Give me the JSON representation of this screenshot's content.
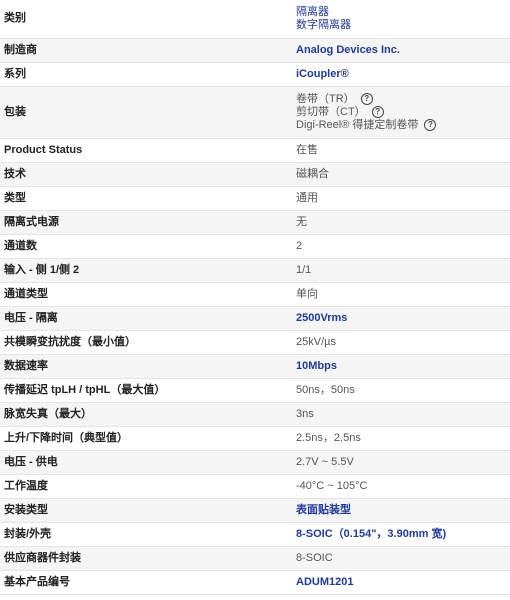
{
  "rows": [
    {
      "label": "类别",
      "values": [
        "隔离器",
        "数字隔离器"
      ]
    },
    {
      "label": "制造商",
      "value": "Analog Devices Inc."
    },
    {
      "label": "系列",
      "value": "iCoupler®"
    },
    {
      "label": "包装",
      "packaging": [
        "卷带（TR）",
        "剪切带（CT）",
        "Digi-Reel® 得捷定制卷带"
      ],
      "help_icon": "question-circle-icon"
    },
    {
      "label": "Product Status",
      "value": "在售"
    },
    {
      "label": "技术",
      "value": "磁耦合"
    },
    {
      "label": "类型",
      "value": "通用"
    },
    {
      "label": "隔离式电源",
      "value": "无"
    },
    {
      "label": "通道数",
      "value": "2"
    },
    {
      "label": "输入 - 侧 1/侧 2",
      "value": "1/1"
    },
    {
      "label": "通道类型",
      "value": "单向"
    },
    {
      "label": "电压 - 隔离",
      "value": "2500Vrms"
    },
    {
      "label": "共模瞬变抗扰度（最小值）",
      "value": "25kV/µs"
    },
    {
      "label": "数据速率",
      "value": "10Mbps"
    },
    {
      "label": "传播延迟 tpLH / tpHL（最大值）",
      "value": "50ns，50ns"
    },
    {
      "label": "脉宽失真（最大）",
      "value": "3ns"
    },
    {
      "label": "上升/下降时间（典型值）",
      "value": "2.5ns，2.5ns"
    },
    {
      "label": "电压 - 供电",
      "value": "2.7V ~ 5.5V"
    },
    {
      "label": "工作温度",
      "value": "-40°C ~ 105°C"
    },
    {
      "label": "安装类型",
      "value": "表面贴装型"
    },
    {
      "label": "封装/外壳",
      "value": "8-SOIC（0.154\"，3.90mm 宽)"
    },
    {
      "label": "供应商器件封装",
      "value": "8-SOIC"
    },
    {
      "label": "基本产品编号",
      "value": "ADUM1201"
    }
  ],
  "colors": {
    "link": "#1f3a9e",
    "stripe": "#f5f5f5",
    "border": "#e3e3e3"
  }
}
